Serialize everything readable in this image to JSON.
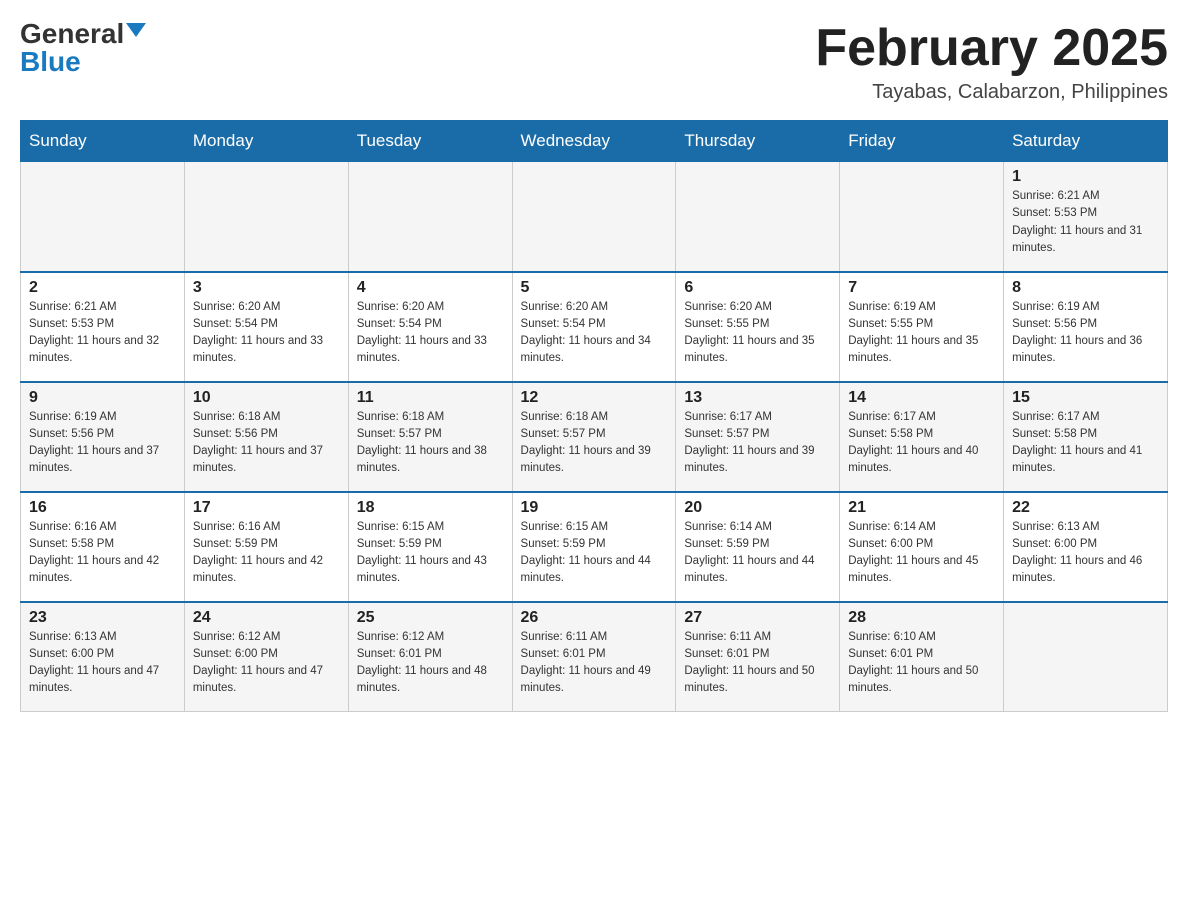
{
  "header": {
    "logo_general": "General",
    "logo_blue": "Blue",
    "month_title": "February 2025",
    "location": "Tayabas, Calabarzon, Philippines"
  },
  "days_of_week": [
    "Sunday",
    "Monday",
    "Tuesday",
    "Wednesday",
    "Thursday",
    "Friday",
    "Saturday"
  ],
  "weeks": [
    {
      "days": [
        {
          "num": "",
          "info": ""
        },
        {
          "num": "",
          "info": ""
        },
        {
          "num": "",
          "info": ""
        },
        {
          "num": "",
          "info": ""
        },
        {
          "num": "",
          "info": ""
        },
        {
          "num": "",
          "info": ""
        },
        {
          "num": "1",
          "info": "Sunrise: 6:21 AM\nSunset: 5:53 PM\nDaylight: 11 hours and 31 minutes."
        }
      ]
    },
    {
      "days": [
        {
          "num": "2",
          "info": "Sunrise: 6:21 AM\nSunset: 5:53 PM\nDaylight: 11 hours and 32 minutes."
        },
        {
          "num": "3",
          "info": "Sunrise: 6:20 AM\nSunset: 5:54 PM\nDaylight: 11 hours and 33 minutes."
        },
        {
          "num": "4",
          "info": "Sunrise: 6:20 AM\nSunset: 5:54 PM\nDaylight: 11 hours and 33 minutes."
        },
        {
          "num": "5",
          "info": "Sunrise: 6:20 AM\nSunset: 5:54 PM\nDaylight: 11 hours and 34 minutes."
        },
        {
          "num": "6",
          "info": "Sunrise: 6:20 AM\nSunset: 5:55 PM\nDaylight: 11 hours and 35 minutes."
        },
        {
          "num": "7",
          "info": "Sunrise: 6:19 AM\nSunset: 5:55 PM\nDaylight: 11 hours and 35 minutes."
        },
        {
          "num": "8",
          "info": "Sunrise: 6:19 AM\nSunset: 5:56 PM\nDaylight: 11 hours and 36 minutes."
        }
      ]
    },
    {
      "days": [
        {
          "num": "9",
          "info": "Sunrise: 6:19 AM\nSunset: 5:56 PM\nDaylight: 11 hours and 37 minutes."
        },
        {
          "num": "10",
          "info": "Sunrise: 6:18 AM\nSunset: 5:56 PM\nDaylight: 11 hours and 37 minutes."
        },
        {
          "num": "11",
          "info": "Sunrise: 6:18 AM\nSunset: 5:57 PM\nDaylight: 11 hours and 38 minutes."
        },
        {
          "num": "12",
          "info": "Sunrise: 6:18 AM\nSunset: 5:57 PM\nDaylight: 11 hours and 39 minutes."
        },
        {
          "num": "13",
          "info": "Sunrise: 6:17 AM\nSunset: 5:57 PM\nDaylight: 11 hours and 39 minutes."
        },
        {
          "num": "14",
          "info": "Sunrise: 6:17 AM\nSunset: 5:58 PM\nDaylight: 11 hours and 40 minutes."
        },
        {
          "num": "15",
          "info": "Sunrise: 6:17 AM\nSunset: 5:58 PM\nDaylight: 11 hours and 41 minutes."
        }
      ]
    },
    {
      "days": [
        {
          "num": "16",
          "info": "Sunrise: 6:16 AM\nSunset: 5:58 PM\nDaylight: 11 hours and 42 minutes."
        },
        {
          "num": "17",
          "info": "Sunrise: 6:16 AM\nSunset: 5:59 PM\nDaylight: 11 hours and 42 minutes."
        },
        {
          "num": "18",
          "info": "Sunrise: 6:15 AM\nSunset: 5:59 PM\nDaylight: 11 hours and 43 minutes."
        },
        {
          "num": "19",
          "info": "Sunrise: 6:15 AM\nSunset: 5:59 PM\nDaylight: 11 hours and 44 minutes."
        },
        {
          "num": "20",
          "info": "Sunrise: 6:14 AM\nSunset: 5:59 PM\nDaylight: 11 hours and 44 minutes."
        },
        {
          "num": "21",
          "info": "Sunrise: 6:14 AM\nSunset: 6:00 PM\nDaylight: 11 hours and 45 minutes."
        },
        {
          "num": "22",
          "info": "Sunrise: 6:13 AM\nSunset: 6:00 PM\nDaylight: 11 hours and 46 minutes."
        }
      ]
    },
    {
      "days": [
        {
          "num": "23",
          "info": "Sunrise: 6:13 AM\nSunset: 6:00 PM\nDaylight: 11 hours and 47 minutes."
        },
        {
          "num": "24",
          "info": "Sunrise: 6:12 AM\nSunset: 6:00 PM\nDaylight: 11 hours and 47 minutes."
        },
        {
          "num": "25",
          "info": "Sunrise: 6:12 AM\nSunset: 6:01 PM\nDaylight: 11 hours and 48 minutes."
        },
        {
          "num": "26",
          "info": "Sunrise: 6:11 AM\nSunset: 6:01 PM\nDaylight: 11 hours and 49 minutes."
        },
        {
          "num": "27",
          "info": "Sunrise: 6:11 AM\nSunset: 6:01 PM\nDaylight: 11 hours and 50 minutes."
        },
        {
          "num": "28",
          "info": "Sunrise: 6:10 AM\nSunset: 6:01 PM\nDaylight: 11 hours and 50 minutes."
        },
        {
          "num": "",
          "info": ""
        }
      ]
    }
  ]
}
